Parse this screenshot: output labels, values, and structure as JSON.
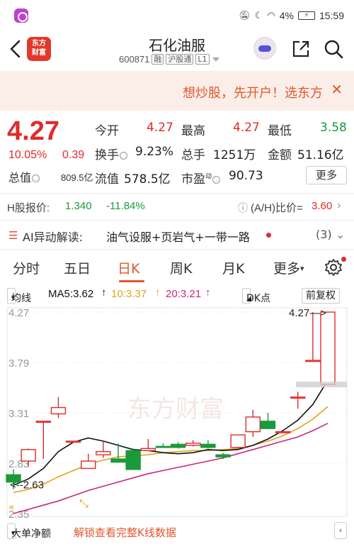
{
  "status_bar": {
    "battery": "4%",
    "time": "15:59"
  },
  "header": {
    "logo_line1": "东方",
    "logo_line2": "财富",
    "stock_name": "石化油服",
    "stock_code": "600871",
    "tags": [
      "融",
      "沪股通",
      "L1"
    ]
  },
  "promo": {
    "text": "想炒股，先开户！选东方",
    "close": "✕"
  },
  "quote": {
    "price": "4.27",
    "change_pct": "10.05%",
    "change_val": "0.39",
    "market_value_label": "总值",
    "market_value": "809.5亿",
    "fields": [
      {
        "label": "今开",
        "value": "4.27"
      },
      {
        "label": "最高",
        "value": "4.27"
      },
      {
        "label": "最低",
        "value": "3.58"
      },
      {
        "label": "换手",
        "value": "9.23%"
      },
      {
        "label": "总手",
        "value": "1251万"
      },
      {
        "label": "金额",
        "value": "51.16亿"
      },
      {
        "label": "流值",
        "value": "578.5亿"
      },
      {
        "label": "市盈",
        "value": "90.73",
        "superscript": "动"
      }
    ],
    "more_label": "更多"
  },
  "h_share": {
    "label": "H股报价:",
    "price": "1.340",
    "change": "-11.84%",
    "ratio_label": "(A/H)比价=",
    "ratio": "3.60"
  },
  "ai_row": {
    "label": "AI异动解读:",
    "text": "油气设服+页岩气+一带一路",
    "count": "(3)"
  },
  "tabs": [
    {
      "label": "分时",
      "active": false
    },
    {
      "label": "五日",
      "active": false
    },
    {
      "label": "日K",
      "active": true
    },
    {
      "label": "周K",
      "active": false
    },
    {
      "label": "月K",
      "active": false
    },
    {
      "label": "更多",
      "active": false
    }
  ],
  "ma_row": {
    "type_label": "均线",
    "ma5": "MA5:3.62",
    "ma10": "10:3.37",
    "ma20": "20:3.21",
    "dk_label": "DK点",
    "adjust_label": "前复权"
  },
  "chart_data": {
    "type": "candlestick",
    "y_ticks": [
      "4.27",
      "3.79",
      "3.31",
      "2.83",
      "2.35"
    ],
    "ylim": [
      2.35,
      4.27
    ],
    "watermark": "东方财富",
    "annotations": {
      "high_label": "4.27",
      "low_label": "2.63"
    },
    "candles": [
      {
        "o": 2.72,
        "c": 2.65,
        "h": 2.77,
        "l": 2.58
      },
      {
        "o": 2.85,
        "c": 2.96,
        "h": 2.97,
        "l": 2.8
      },
      {
        "o": 3.23,
        "c": 3.23,
        "h": 3.23,
        "l": 2.87
      },
      {
        "o": 3.3,
        "c": 3.36,
        "h": 3.46,
        "l": 3.26
      },
      {
        "o": 3.04,
        "c": 3.04,
        "h": 3.04,
        "l": 3.04
      },
      {
        "o": 2.78,
        "c": 2.85,
        "h": 2.92,
        "l": 2.78
      },
      {
        "o": 2.91,
        "c": 2.94,
        "h": 3.04,
        "l": 2.88
      },
      {
        "o": 2.87,
        "c": 2.84,
        "h": 3.02,
        "l": 2.84
      },
      {
        "o": 2.95,
        "c": 2.77,
        "h": 2.97,
        "l": 2.77
      },
      {
        "o": 2.95,
        "c": 2.97,
        "h": 3.06,
        "l": 2.95
      },
      {
        "o": 2.99,
        "c": 2.98,
        "h": 3.02,
        "l": 2.98
      },
      {
        "o": 3.01,
        "c": 2.98,
        "h": 3.03,
        "l": 2.97
      },
      {
        "o": 3.0,
        "c": 3.02,
        "h": 3.05,
        "l": 2.99
      },
      {
        "o": 3.01,
        "c": 2.98,
        "h": 3.05,
        "l": 2.97
      },
      {
        "o": 2.91,
        "c": 2.89,
        "h": 2.93,
        "l": 2.87
      },
      {
        "o": 2.98,
        "c": 3.1,
        "h": 3.1,
        "l": 2.97
      },
      {
        "o": 3.13,
        "c": 3.27,
        "h": 3.34,
        "l": 3.08
      },
      {
        "o": 3.23,
        "c": 3.16,
        "h": 3.31,
        "l": 3.16
      },
      {
        "o": 3.13,
        "c": 3.13,
        "h": 3.13,
        "l": 3.13
      },
      {
        "o": 3.46,
        "c": 3.46,
        "h": 3.51,
        "l": 3.35
      },
      {
        "o": 3.81,
        "c": 3.81,
        "h": 4.27,
        "l": 3.81
      },
      {
        "o": 3.58,
        "c": 4.27,
        "h": 4.27,
        "l": 3.58
      }
    ],
    "series": [
      {
        "values": [
          2.62,
          2.68,
          2.78,
          2.94,
          3.03,
          3.07,
          3.04,
          3.0,
          2.96,
          2.95,
          2.93,
          2.92,
          2.93,
          2.96,
          2.95,
          2.96,
          3.0,
          3.06,
          3.14,
          3.24,
          3.39,
          3.62
        ]
      },
      {
        "values": [
          2.55,
          2.58,
          2.63,
          2.7,
          2.76,
          2.82,
          2.86,
          2.89,
          2.9,
          2.91,
          2.93,
          2.94,
          2.95,
          2.95,
          2.96,
          2.97,
          3.0,
          3.04,
          3.09,
          3.16,
          3.25,
          3.37
        ]
      },
      {
        "values": [
          2.35,
          2.39,
          2.43,
          2.47,
          2.52,
          2.57,
          2.61,
          2.65,
          2.69,
          2.73,
          2.76,
          2.79,
          2.82,
          2.85,
          2.88,
          2.92,
          2.96,
          3.0,
          3.04,
          3.08,
          3.14,
          3.21
        ]
      }
    ]
  },
  "bottom_row": {
    "indicator_label": "大单净额",
    "unlock_text": "解锁查看完整K线数据"
  },
  "colors": {
    "up": "#e02b2b",
    "down": "#1a9a3a",
    "accent": "#e0562e",
    "ma5": "#111111",
    "ma10": "#e8a020",
    "ma20": "#c8287e"
  }
}
